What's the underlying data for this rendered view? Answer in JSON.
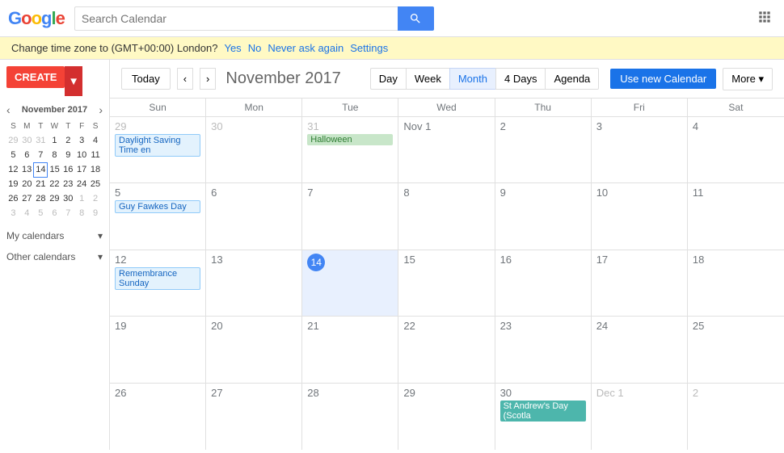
{
  "topBar": {
    "logo": "Google",
    "searchPlaceholder": "Search Calendar",
    "appsLabel": "Apps"
  },
  "tzBanner": {
    "message": "Change time zone to (GMT+00:00) London?",
    "yes": "Yes",
    "no": "No",
    "neverAskAgain": "Never ask again",
    "settings": "Settings"
  },
  "sidebar": {
    "createLabel": "CREATE",
    "miniCal": {
      "title": "November 2017",
      "dayHeaders": [
        "S",
        "M",
        "T",
        "W",
        "T",
        "F",
        "S"
      ],
      "weeks": [
        [
          {
            "day": "29",
            "otherMonth": true
          },
          {
            "day": "30",
            "otherMonth": true
          },
          {
            "day": "31",
            "otherMonth": true
          },
          {
            "day": "1"
          },
          {
            "day": "2"
          },
          {
            "day": "3"
          },
          {
            "day": "4"
          }
        ],
        [
          {
            "day": "5"
          },
          {
            "day": "6"
          },
          {
            "day": "7"
          },
          {
            "day": "8"
          },
          {
            "day": "9"
          },
          {
            "day": "10"
          },
          {
            "day": "11"
          }
        ],
        [
          {
            "day": "12"
          },
          {
            "day": "13"
          },
          {
            "day": "14",
            "selected": true
          },
          {
            "day": "15"
          },
          {
            "day": "16"
          },
          {
            "day": "17"
          },
          {
            "day": "18"
          }
        ],
        [
          {
            "day": "19"
          },
          {
            "day": "20"
          },
          {
            "day": "21"
          },
          {
            "day": "22"
          },
          {
            "day": "23"
          },
          {
            "day": "24"
          },
          {
            "day": "25"
          }
        ],
        [
          {
            "day": "26"
          },
          {
            "day": "27"
          },
          {
            "day": "28"
          },
          {
            "day": "29"
          },
          {
            "day": "30"
          },
          {
            "day": "1",
            "otherMonth": true
          },
          {
            "day": "2",
            "otherMonth": true
          }
        ],
        [
          {
            "day": "3",
            "otherMonth": true
          },
          {
            "day": "4",
            "otherMonth": true
          },
          {
            "day": "5",
            "otherMonth": true
          },
          {
            "day": "6",
            "otherMonth": true
          },
          {
            "day": "7",
            "otherMonth": true
          },
          {
            "day": "8",
            "otherMonth": true
          },
          {
            "day": "9",
            "otherMonth": true
          }
        ]
      ]
    },
    "myCalendarsLabel": "My calendars",
    "otherCalendarsLabel": "Other calendars"
  },
  "toolbar": {
    "todayLabel": "Today",
    "monthTitle": "November 2017",
    "viewDay": "Day",
    "viewWeek": "Week",
    "viewMonth": "Month",
    "view4Days": "4 Days",
    "viewAgenda": "Agenda",
    "useNewCalendar": "Use new Calendar",
    "more": "More ▾"
  },
  "calGrid": {
    "dayHeaders": [
      "Sun",
      "Mon",
      "Tue",
      "Wed",
      "Thu",
      "Fri",
      "Sat"
    ],
    "weeks": [
      {
        "cells": [
          {
            "day": "29",
            "otherMonth": true,
            "events": []
          },
          {
            "day": "30",
            "otherMonth": true,
            "events": []
          },
          {
            "day": "31",
            "otherMonth": true,
            "events": [
              {
                "label": "Halloween",
                "style": "event-green"
              }
            ]
          },
          {
            "day": "Nov 1",
            "events": []
          },
          {
            "day": "2",
            "events": []
          },
          {
            "day": "3",
            "events": []
          },
          {
            "day": "4",
            "events": []
          }
        ]
      },
      {
        "cells": [
          {
            "day": "5",
            "events": [
              {
                "label": "Guy Fawkes Day",
                "style": "event-blue-outline"
              }
            ]
          },
          {
            "day": "6",
            "events": []
          },
          {
            "day": "7",
            "events": []
          },
          {
            "day": "8",
            "events": []
          },
          {
            "day": "9",
            "events": []
          },
          {
            "day": "10",
            "events": []
          },
          {
            "day": "11",
            "events": []
          }
        ]
      },
      {
        "cells": [
          {
            "day": "12",
            "events": [
              {
                "label": "Remembrance Sunday",
                "style": "event-blue-outline"
              }
            ]
          },
          {
            "day": "13",
            "events": []
          },
          {
            "day": "14",
            "today": true,
            "events": []
          },
          {
            "day": "15",
            "events": []
          },
          {
            "day": "16",
            "events": []
          },
          {
            "day": "17",
            "events": []
          },
          {
            "day": "18",
            "events": []
          }
        ]
      },
      {
        "cells": [
          {
            "day": "19",
            "events": []
          },
          {
            "day": "20",
            "events": []
          },
          {
            "day": "21",
            "events": []
          },
          {
            "day": "22",
            "events": []
          },
          {
            "day": "23",
            "events": []
          },
          {
            "day": "24",
            "events": []
          },
          {
            "day": "25",
            "events": []
          }
        ]
      },
      {
        "cells": [
          {
            "day": "26",
            "events": []
          },
          {
            "day": "27",
            "events": []
          },
          {
            "day": "28",
            "events": []
          },
          {
            "day": "29",
            "events": []
          },
          {
            "day": "30",
            "events": [
              {
                "label": "St Andrew's Day (Scotla",
                "style": "event-teal"
              }
            ]
          },
          {
            "day": "Dec 1",
            "otherMonth": true,
            "events": []
          },
          {
            "day": "2",
            "otherMonth": true,
            "events": []
          }
        ]
      }
    ],
    "daylightSavingEvent": "Daylight Saving Time en"
  }
}
